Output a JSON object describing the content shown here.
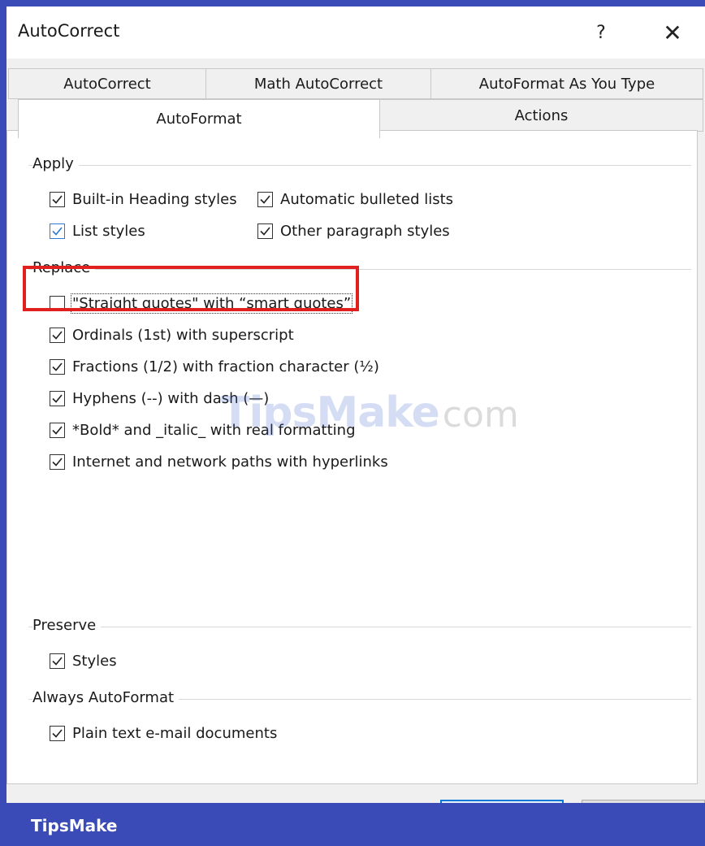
{
  "window": {
    "title": "AutoCorrect",
    "help_label": "?",
    "close_label": "✕"
  },
  "tabs": {
    "row1": [
      "AutoCorrect",
      "Math AutoCorrect",
      "AutoFormat As You Type"
    ],
    "row2": [
      "AutoFormat",
      "Actions"
    ],
    "active": "AutoFormat"
  },
  "apply": {
    "label": "Apply",
    "options": [
      {
        "text": "Built-in Heading styles",
        "checked": true
      },
      {
        "text": "Automatic bulleted lists",
        "checked": true
      },
      {
        "text": "List styles",
        "checked": true
      },
      {
        "text": "Other paragraph styles",
        "checked": true
      }
    ]
  },
  "replace": {
    "label": "Replace",
    "options": [
      {
        "text": "\"Straight quotes\" with “smart quotes”",
        "checked": false
      },
      {
        "text": "Ordinals (1st) with superscript",
        "checked": true
      },
      {
        "text": "Fractions (1/2) with fraction character (½)",
        "checked": true
      },
      {
        "text": "Hyphens (--) with dash (—)",
        "checked": true
      },
      {
        "text": "*Bold* and _italic_ with real formatting",
        "checked": true
      },
      {
        "text": "Internet and network paths with hyperlinks",
        "checked": true
      }
    ]
  },
  "preserve": {
    "label": "Preserve",
    "options": [
      {
        "text": "Styles",
        "checked": true
      }
    ]
  },
  "always": {
    "label": "Always AutoFormat",
    "options": [
      {
        "text": "Plain text e-mail documents",
        "checked": true
      }
    ]
  },
  "watermark": {
    "brand": "TipsMake",
    "sub": "com"
  },
  "footer": {
    "text": "TipsMake"
  },
  "colors": {
    "highlight": "#e01f1f",
    "frame": "#3a4bb8"
  }
}
